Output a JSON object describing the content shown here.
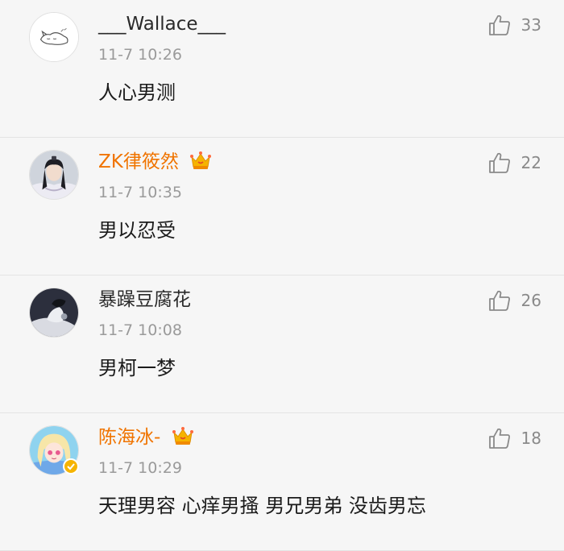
{
  "comments": [
    {
      "username": "___Wallace___",
      "time": "11-7 10:26",
      "text": "人心男测",
      "likes": "33",
      "vip": false,
      "verified": false
    },
    {
      "username": "ZK律筱然",
      "time": "11-7 10:35",
      "text": "男以忍受",
      "likes": "22",
      "vip": true,
      "verified": false
    },
    {
      "username": "暴躁豆腐花",
      "time": "11-7 10:08",
      "text": "男柯一梦",
      "likes": "26",
      "vip": false,
      "verified": false
    },
    {
      "username": "陈海冰-",
      "time": "11-7 10:29",
      "text": "天理男容 心痒男搔 男兄男弟 没齿男忘",
      "likes": "18",
      "vip": true,
      "verified": true
    }
  ],
  "icons": {
    "like": "thumbs-up-icon",
    "crown": "crown-icon",
    "verified": "verified-badge-icon"
  },
  "colors": {
    "background": "#f6f6f6",
    "vip_name": "#f07400",
    "timestamp": "#9a9a9a",
    "like_icon": "#8a8a8a",
    "verified_badge": "#f6b400"
  }
}
